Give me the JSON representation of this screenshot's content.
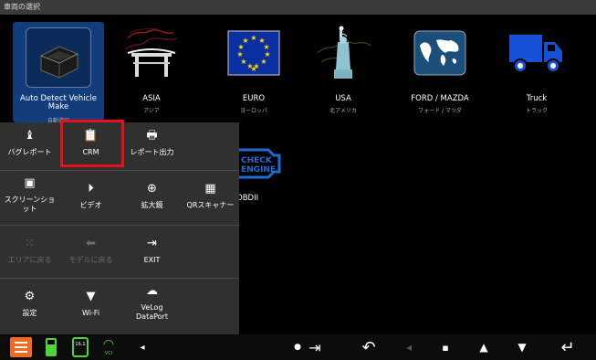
{
  "window": {
    "title": "車両の選択"
  },
  "makes": [
    {
      "label": "Auto Detect Vehicle Make",
      "sublabel": "自動選択",
      "icon": "obd-dongle-icon",
      "selected": true
    },
    {
      "label": "ASIA",
      "sublabel": "アジア",
      "icon": "asia-gate-icon"
    },
    {
      "label": "EURO",
      "sublabel": "ヨーロッパ",
      "icon": "eu-flag-icon"
    },
    {
      "label": "USA",
      "sublabel": "北アメリカ",
      "icon": "statue-of-liberty-icon"
    },
    {
      "label": "FORD / MAZDA",
      "sublabel": "フォード / マツダ",
      "icon": "world-map-icon"
    },
    {
      "label": "Truck",
      "sublabel": "トラック",
      "icon": "truck-icon"
    }
  ],
  "obd": {
    "label": "OBDII",
    "icon_text": "CHECK ENGINE",
    "icon": "check-engine-icon"
  },
  "menu": {
    "rows": [
      [
        {
          "label": "バグレポート",
          "icon": "bug-report-icon"
        },
        {
          "label": "CRM",
          "icon": "clipboard-icon",
          "highlighted": true
        },
        {
          "label": "レポート出力",
          "icon": "report-output-icon"
        }
      ],
      [
        {
          "label": "スクリーンショット",
          "icon": "screenshot-icon"
        },
        {
          "label": "ビデオ",
          "icon": "video-icon"
        },
        {
          "label": "拡大鏡",
          "icon": "magnifier-icon"
        },
        {
          "label": "QRスキャナー",
          "icon": "qr-code-icon"
        }
      ],
      [
        {
          "label": "エリアに戻る",
          "icon": "grid-icon",
          "disabled": true
        },
        {
          "label": "モデルに戻る",
          "icon": "back-arrow-icon",
          "disabled": true
        },
        {
          "label": "EXIT",
          "icon": "exit-icon"
        }
      ],
      [
        {
          "label": "設定",
          "icon": "gear-icon"
        },
        {
          "label": "Wi-Fi",
          "icon": "wifi-icon"
        },
        {
          "label": "VeLog DataPort",
          "icon": "cloud-upload-icon"
        }
      ]
    ]
  },
  "taskbar": {
    "battery_label": "",
    "vci_label": "VCI",
    "version_label": "16.1",
    "accent": "#f26b1d"
  },
  "colors": {
    "highlight": "#e8111a",
    "selected_tile": "#123c7a",
    "truck_blue": "#1650d6"
  }
}
